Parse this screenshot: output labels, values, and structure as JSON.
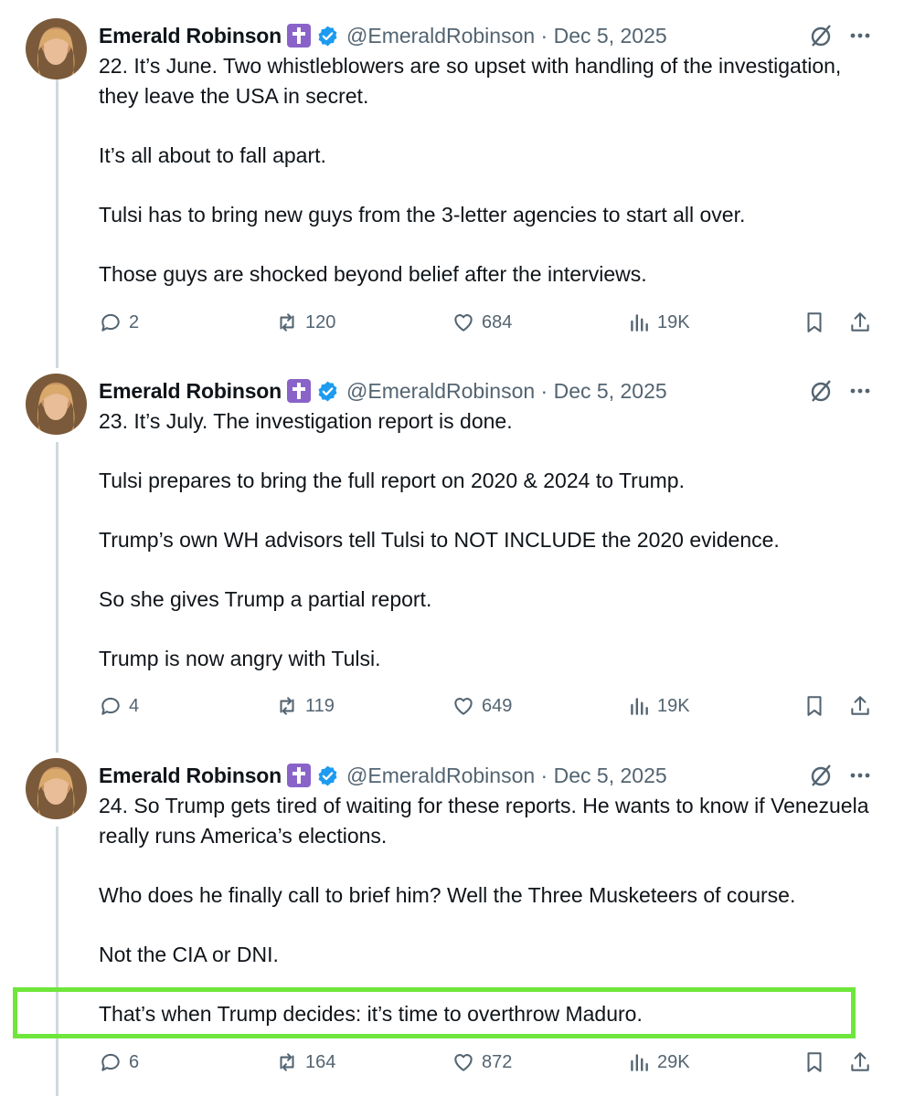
{
  "author": {
    "name": "Emerald Robinson",
    "handle": "@EmeraldRobinson"
  },
  "tweets": [
    {
      "date": "Dec 5, 2025",
      "paragraphs": [
        "22. It’s June. Two whistleblowers are so upset with handling of the investigation, they leave the USA in secret.",
        "It’s all about to fall apart.",
        "Tulsi has to bring new guys from the 3-letter agencies to start all over.",
        "Those guys are shocked beyond belief after the interviews."
      ],
      "replies": "2",
      "reposts": "120",
      "likes": "684",
      "views": "19K"
    },
    {
      "date": "Dec 5, 2025",
      "paragraphs": [
        "23. It’s July. The investigation report is done.",
        "Tulsi prepares to bring the full report on 2020 & 2024 to Trump.",
        "Trump’s own WH advisors tell Tulsi to NOT INCLUDE the 2020 evidence.",
        "So she gives Trump a partial report.",
        "Trump is now angry with Tulsi."
      ],
      "replies": "4",
      "reposts": "119",
      "likes": "649",
      "views": "19K"
    },
    {
      "date": "Dec 5, 2025",
      "paragraphs": [
        "24. So Trump gets tired of waiting for these reports. He wants to know if Venezuela really runs America’s elections.",
        "Who does he finally call to brief him? Well the Three Musketeers of course.",
        "Not the CIA or DNI.",
        "That’s when Trump decides: it’s time to overthrow Maduro."
      ],
      "replies": "6",
      "reposts": "164",
      "likes": "872",
      "views": "29K"
    }
  ],
  "icons": {
    "verified": "verified-badge-icon",
    "badge": "cross-badge-icon",
    "grok": "grok-icon",
    "more": "more-icon",
    "reply": "reply-icon",
    "repost": "repost-icon",
    "like": "like-icon",
    "views": "views-icon",
    "bookmark": "bookmark-icon",
    "share": "share-icon"
  },
  "colors": {
    "text": "#0f1419",
    "secondary": "#536471",
    "verified_blue": "#1d9bf0",
    "badge_purple": "#8a63c9",
    "highlight_green": "#6fe63b",
    "thread_line": "#cfd9de"
  }
}
